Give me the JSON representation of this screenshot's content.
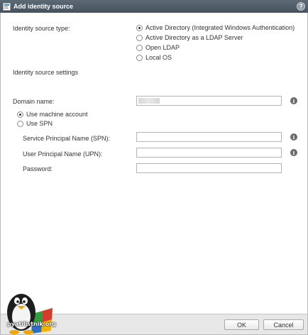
{
  "window": {
    "title": "Add identity source",
    "help_label": "?"
  },
  "identity_source_type": {
    "label": "Identity source type:",
    "options": [
      {
        "label": "Active Directory (Integrated Windows Authentication)",
        "selected": true
      },
      {
        "label": "Active Directory as a LDAP Server",
        "selected": false
      },
      {
        "label": "Open LDAP",
        "selected": false
      },
      {
        "label": "Local OS",
        "selected": false
      }
    ]
  },
  "settings": {
    "section_label": "Identity source settings",
    "domain_name_label": "Domain name:",
    "use_machine_account_label": "Use machine account",
    "use_spn_label": "Use SPN",
    "spn_label": "Service Principal Name (SPN):",
    "upn_label": "User Principal Name (UPN):",
    "password_label": "Password:",
    "info_glyph": "i"
  },
  "footer": {
    "ok_label": "OK",
    "cancel_label": "Cancel"
  },
  "watermark": {
    "text": "pyatilistnik.org"
  },
  "colors": {
    "titlebar": "#4f5b66",
    "footer": "#e7e7e7"
  }
}
